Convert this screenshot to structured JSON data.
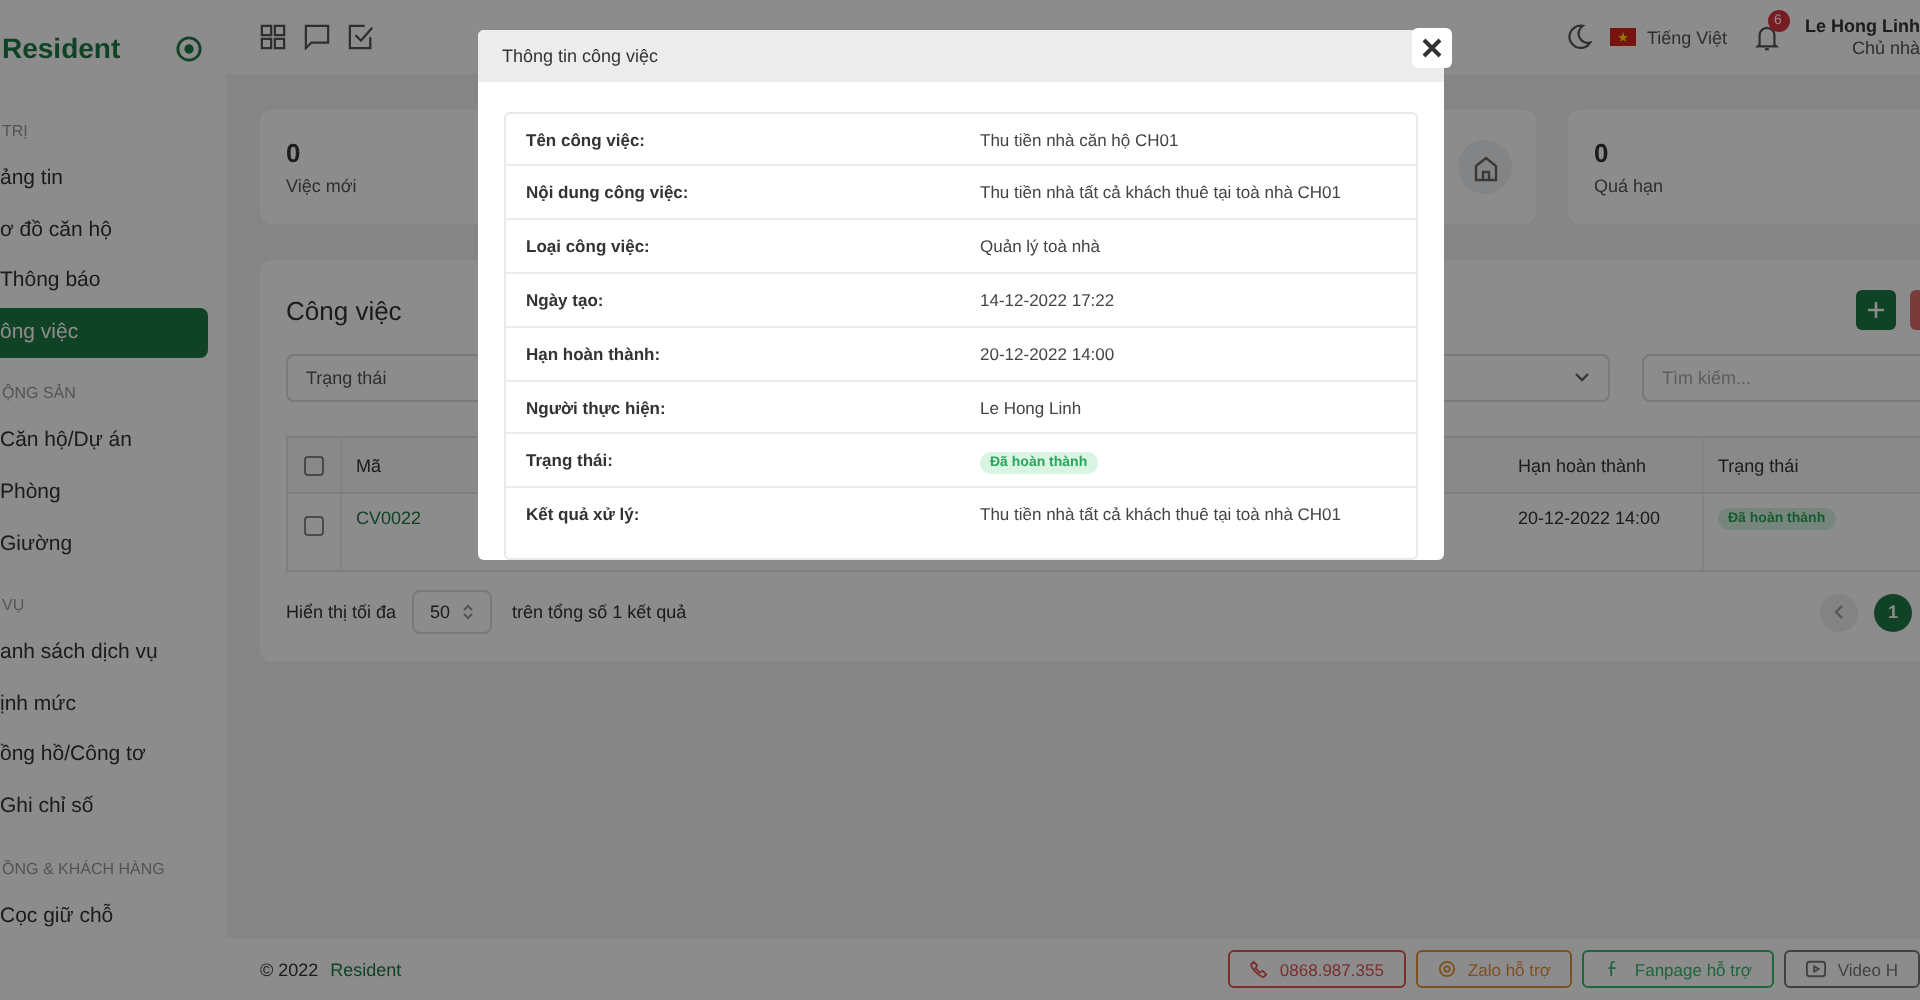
{
  "sidebar": {
    "logo": "Resident",
    "sections": [
      {
        "title": "TRỊ",
        "items": [
          {
            "label": "ảng tin",
            "selected": false
          },
          {
            "label": "ơ đồ căn hộ",
            "selected": false
          },
          {
            "label": "Thông báo",
            "selected": false
          },
          {
            "label": "ông việc",
            "selected": true
          }
        ]
      },
      {
        "title": "ỘNG SẢN",
        "items": [
          {
            "label": "Căn hộ/Dự án",
            "selected": false
          },
          {
            "label": "Phòng",
            "selected": false
          },
          {
            "label": "Giường",
            "selected": false
          }
        ]
      },
      {
        "title": "VỤ",
        "items": [
          {
            "label": "anh sách dịch vụ",
            "selected": false
          },
          {
            "label": "ịnh mức",
            "selected": false
          },
          {
            "label": "ồng hồ/Công tơ",
            "selected": false
          },
          {
            "label": "Ghi chỉ số",
            "selected": false
          }
        ]
      },
      {
        "title": "ỒNG & KHÁCH HÀNG",
        "items": [
          {
            "label": "Cọc giữ chỗ",
            "selected": false
          }
        ]
      }
    ]
  },
  "header": {
    "language": "Tiếng Việt",
    "notifications": "6",
    "user": {
      "name": "Le Hong Linh",
      "role": "Chủ nhà"
    }
  },
  "stats": [
    {
      "kind": "full",
      "value": "0",
      "label": "Việc mới"
    },
    {
      "kind": "covered"
    },
    {
      "kind": "full",
      "value": "0",
      "label": "Quá hạn"
    }
  ],
  "panel": {
    "title": "Công việc",
    "filter_placeholder": "Trạng thái",
    "search_placeholder": "Tìm kiếm...",
    "table": {
      "header_checked": false,
      "columns": [
        {
          "label": "Mã"
        },
        {
          "label": "Hạn hoàn thành"
        },
        {
          "label": "Trạng thái"
        }
      ],
      "rows": [
        {
          "checked": false,
          "code": "CV0022",
          "deadline": "20-12-2022 14:00",
          "status": "Đã hoàn thành"
        }
      ]
    },
    "pagination": {
      "prefix": "Hiển thị tối đa",
      "page_size": "50",
      "suffix": "trên tổng số 1 kết quả",
      "pages": [
        {
          "label": "1",
          "selected": true
        }
      ]
    }
  },
  "footer": {
    "copyright": "© 2022",
    "brand": "Resident",
    "buttons": [
      {
        "kind": "phone",
        "label": "0868.987.355"
      },
      {
        "kind": "zalo",
        "label": "Zalo hỗ trợ"
      },
      {
        "kind": "fanpage",
        "label": "Fanpage hỗ trợ"
      },
      {
        "kind": "video",
        "label": "Video H"
      }
    ]
  },
  "modal": {
    "title": "Thông tin công việc",
    "fields": [
      {
        "kind": "text",
        "label": "Tên công việc:",
        "value": "Thu tiền nhà căn hộ CH01"
      },
      {
        "kind": "text",
        "label": "Nội dung công việc:",
        "value": "Thu tiền nhà tất cả khách thuê tại toà nhà CH01"
      },
      {
        "kind": "text",
        "label": "Loại công việc:",
        "value": "Quản lý toà nhà"
      },
      {
        "kind": "text",
        "label": "Ngày tạo:",
        "value": "14-12-2022 17:22"
      },
      {
        "kind": "text",
        "label": "Hạn hoàn thành:",
        "value": "20-12-2022 14:00"
      },
      {
        "kind": "text",
        "label": "Người thực hiện:",
        "value": "Le Hong Linh"
      },
      {
        "kind": "badge",
        "label": "Trạng thái:",
        "value": "Đã hoàn thành"
      },
      {
        "kind": "text",
        "label": "Kết quả xử lý:",
        "value": "Thu tiền nhà tất cả khách thuê tại toà nhà CH01"
      }
    ]
  }
}
